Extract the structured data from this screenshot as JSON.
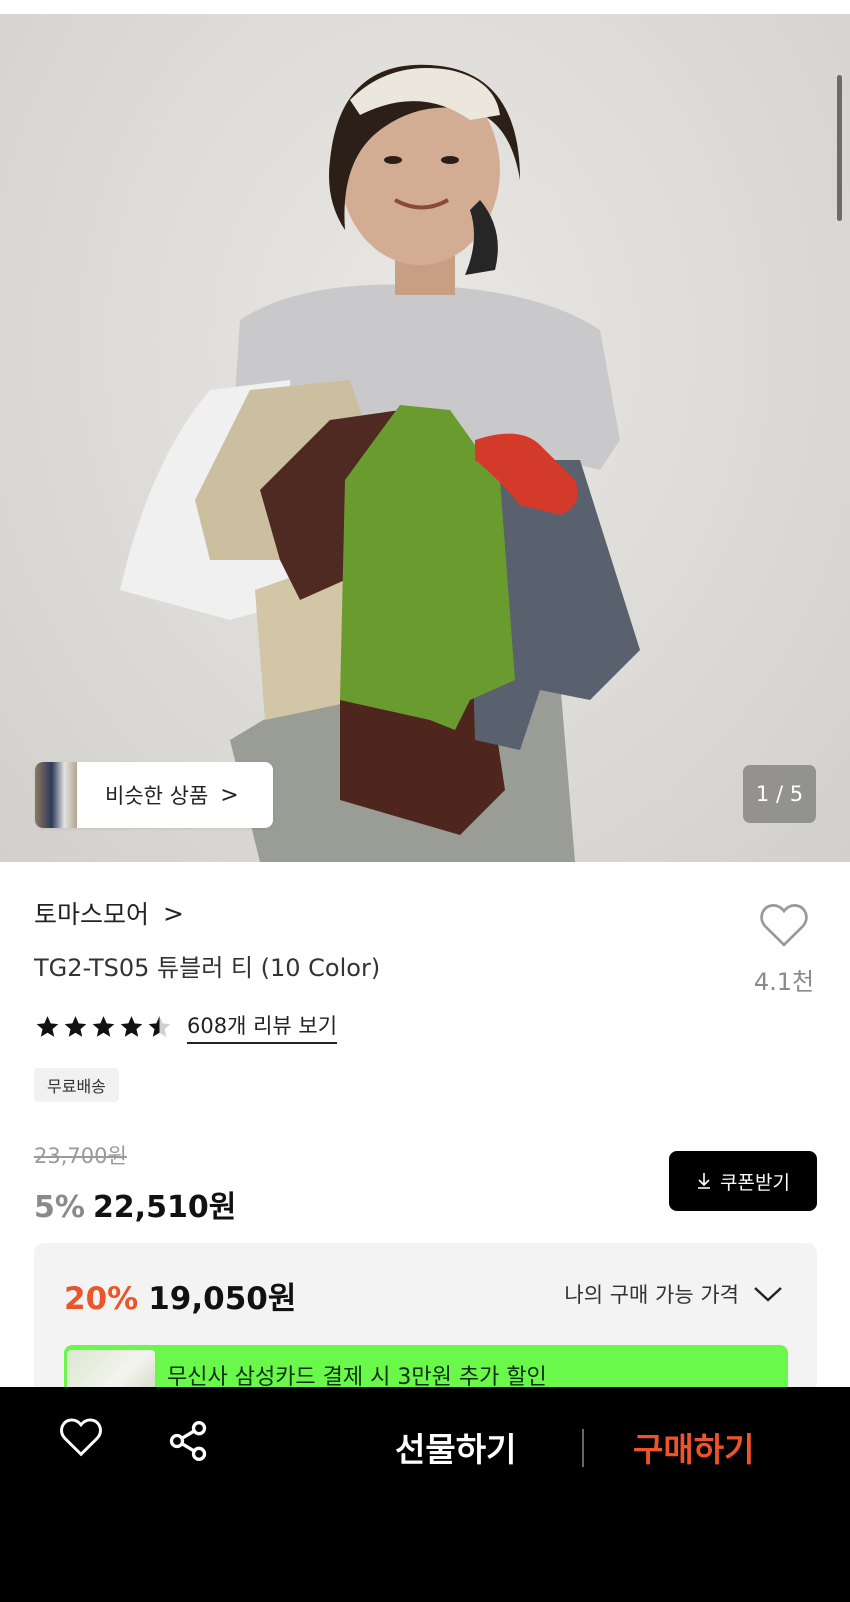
{
  "gallery": {
    "similar_label": "비슷한 상품",
    "similar_chevron": ">",
    "counter": "1 / 5"
  },
  "product": {
    "brand": "토마스모어",
    "brand_chevron": ">",
    "title": "TG2-TS05 튜블러 티 (10 Color)",
    "like_count": "4.1천",
    "rating": 4.5,
    "review_link": "608개 리뷰 보기",
    "badge": "무료배송"
  },
  "price": {
    "original": "23,700원",
    "discount_pct": "5%",
    "sale_price": "22,510원",
    "coupon_label": "쿠폰받기"
  },
  "benefit": {
    "pct": "20%",
    "price": "19,050원",
    "my_price_label": "나의 구매 가능 가격",
    "promo_text": "무신사 삼성카드 결제 시 3만원 추가 할인"
  },
  "bottom_bar": {
    "gift_label": "선물하기",
    "buy_label": "구매하기"
  },
  "icons": [
    "heart-icon",
    "share-icon",
    "chevron-down-icon",
    "download-icon",
    "star-icon"
  ],
  "colors": {
    "accent_orange": "#f0532a",
    "discount_orange": "#e8562a",
    "promo_green": "#6af94a",
    "bottom_bar": "#000000"
  }
}
